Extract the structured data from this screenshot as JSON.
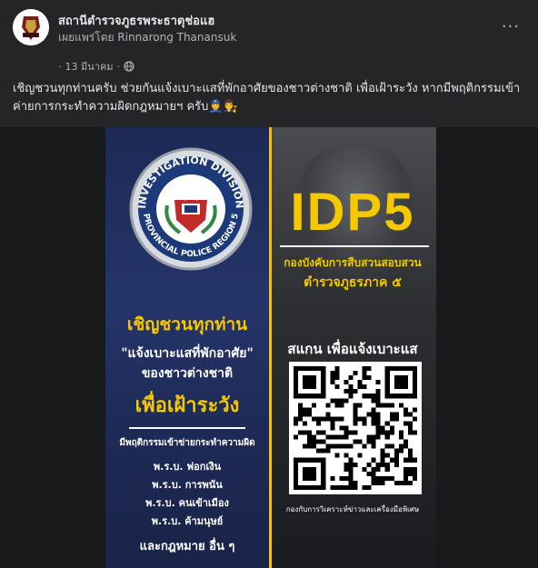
{
  "post": {
    "page_name": "สถานีตำรวจภูธรพระธาตุช่อแฮ",
    "published_by": "เผยแพร่โดย Rinnarong Thanansuk",
    "date": "13 มีนาคม",
    "dot": "·",
    "caption": "เชิญชวนทุกท่านครับ ช่วยกันแจ้งเบาะแสที่พักอาศัยของชาวต่างชาติ เพื่อเฝ้าระวัง หากมีพฤติกรรมเข้าค่ายการกระทำความผิดกฎหมายฯ ครับ👮‍♂️👨‍⚖️",
    "more_icon": "..."
  },
  "poster": {
    "emblem_top": "INVESTIGATION DIVISION",
    "emblem_bottom": "PROVINCIAL POLICE REGION 5",
    "headline": "IDP5",
    "unit_line1": "กองบังคับการสืบสวนสอบสวน",
    "unit_line2": "ตำรวจภูธรภาค ๕",
    "invite": "เชิญชวนทุกท่าน",
    "quote": "\"แจ้งเบาะแสที่พักอาศัย\"",
    "foreigners": "ของชาวต่างชาติ",
    "watch": "เพื่อเฝ้าระวัง",
    "behavior": "มีพฤติกรรมเข้าข่ายกระทำความผิด",
    "laws": [
      "พ.ร.บ. ฟอกเงิน",
      "พ.ร.บ. การพนัน",
      "พ.ร.บ. คนเข้าเมือง",
      "พ.ร.บ. ค้ามนุษย์"
    ],
    "other_laws": "และกฎหมาย อื่น ๆ",
    "scan": "สแกน เพื่อแจ้งเบาะแส",
    "footer": "กองกับการวิเคราะห์ข่าวและเครื่องมือพิเศษ"
  },
  "colors": {
    "accent_yellow": "#f5c800",
    "panel_blue": "#1d2a55",
    "background": "#242526"
  }
}
